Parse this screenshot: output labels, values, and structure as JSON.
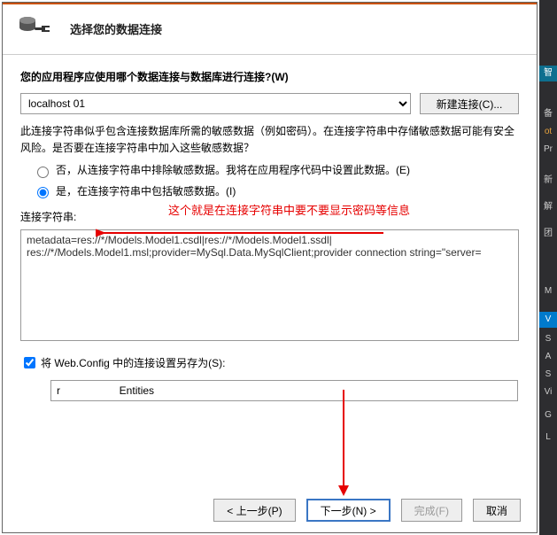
{
  "header": {
    "title": "选择您的数据连接"
  },
  "question": "您的应用程序应使用哪个数据连接与数据库进行连接?(W)",
  "combo": {
    "value": "localhost                01",
    "new_button": "新建连接(C)..."
  },
  "explain": "此连接字符串似乎包含连接数据库所需的敏感数据（例如密码）。在连接字符串中存储敏感数据可能有安全风险。是否要在连接字符串中加入这些敏感数据？",
  "radio": {
    "no": "否，从连接字符串中排除敏感数据。我将在应用程序代码中设置此数据。(E)",
    "yes": "是，在连接字符串中包括敏感数据。(I)"
  },
  "annotation": "这个就是在连接字符串中要不要显示密码等信息",
  "cs_label": "连接字符串:",
  "cs_value": "metadata=res://*/Models.Model1.csdl|res://*/Models.Model1.ssdl|\nres://*/Models.Model1.msl;provider=MySql.Data.MySqlClient;provider connection string=\"server=",
  "save_check": "将 Web.Config 中的连接设置另存为(S):",
  "save_value": "r                    Entities",
  "footer": {
    "prev": "< 上一步(P)",
    "next": "下一步(N) >",
    "finish": "完成(F)",
    "cancel": "取消"
  },
  "right_tabs": [
    "智",
    "备",
    "ot",
    "Pr",
    "新",
    "解",
    "团",
    "M",
    "V",
    "S",
    "A",
    "S",
    "Vi",
    "G",
    "L"
  ]
}
